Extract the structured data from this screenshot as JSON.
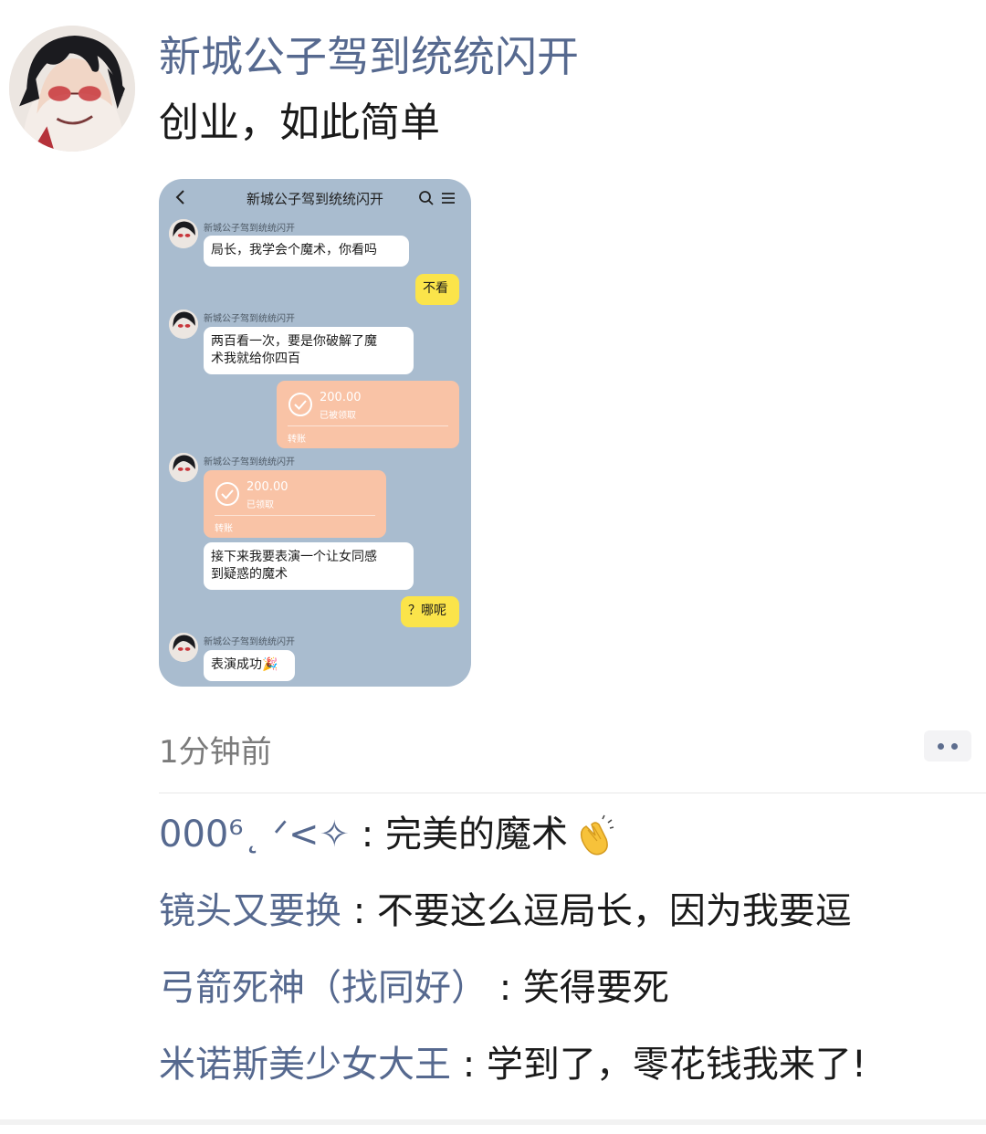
{
  "post": {
    "author": "新城公子驾到统统闪开",
    "text": "创业，如此简单",
    "time": "1分钟前"
  },
  "screenshot": {
    "title": "新城公子驾到统统闪开",
    "messages": [
      {
        "sender": "新城公子驾到统统闪开",
        "text": "局长，我学会个魔术，你看吗"
      },
      {
        "me_text": "不看"
      },
      {
        "sender": "新城公子驾到统统闪开",
        "text_line1": "两百看一次，要是你破解了魔",
        "text_line2": "术我就给你四百"
      },
      {
        "amount": "200.00",
        "status": "已被领取",
        "kind": "转账"
      },
      {
        "sender": "新城公子驾到统统闪开",
        "amount": "200.00",
        "status": "已领取",
        "kind": "转账"
      },
      {
        "text_line1": "接下来我要表演一个让女同感",
        "text_line2": "到疑惑的魔术"
      },
      {
        "me_text": "？哪呢"
      },
      {
        "sender": "新城公子驾到统统闪开",
        "text": "表演成功🎉"
      }
    ]
  },
  "comments": [
    {
      "name": "000⁶˛ ᐟ<✧",
      "sep": ":",
      "text": "完美的魔术"
    },
    {
      "name": "镜头又要换",
      "sep": ":",
      "text": "不要这么逗局长，因为我要逗"
    },
    {
      "name": "弓箭死神（找同好）",
      "sep": ":",
      "text": "笑得要死"
    },
    {
      "name": "米诺斯美少女大王",
      "sep": ":",
      "text": "学到了，零花钱我来了!"
    }
  ],
  "icons": {
    "more": "more-dots-icon",
    "clap": "clapping-hands-icon",
    "back": "back-arrow-icon",
    "search": "search-icon",
    "menu": "menu-icon"
  },
  "colors": {
    "name_link": "#56698f",
    "chat_bg": "#a9bccf",
    "my_bubble": "#fbe44a",
    "transfer": "#f9c3a6"
  }
}
